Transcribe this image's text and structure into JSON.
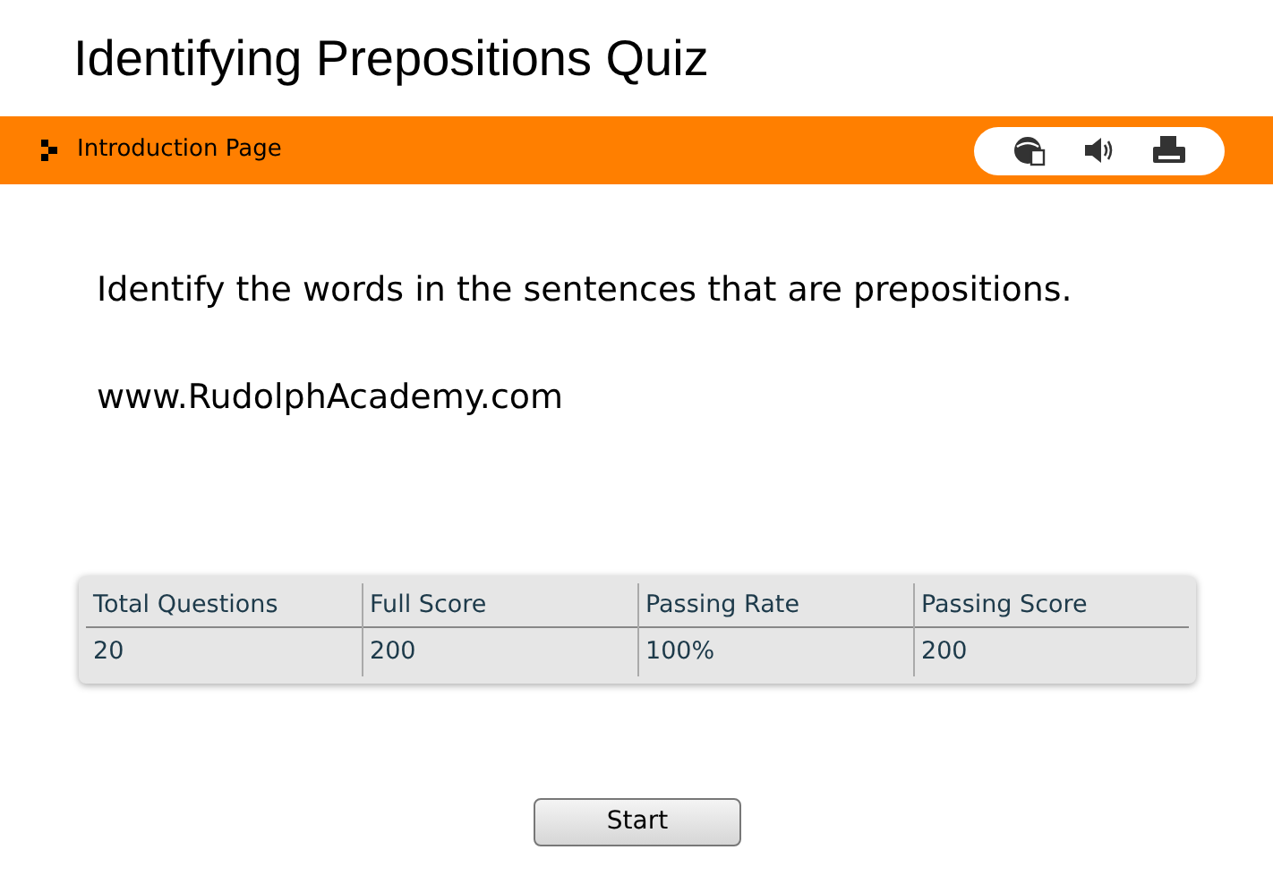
{
  "title": "Identifying Prepositions Quiz",
  "nav": {
    "label": "Introduction Page"
  },
  "body": [
    "Identify the words in the sentences that are prepositions.",
    "www.RudolphAcademy.com"
  ],
  "table": {
    "columns": [
      "Total Questions",
      "Full Score",
      "Passing Rate",
      "Passing Score"
    ],
    "rows": [
      [
        "20",
        "200",
        "100%",
        "200"
      ]
    ]
  },
  "button": "Start"
}
